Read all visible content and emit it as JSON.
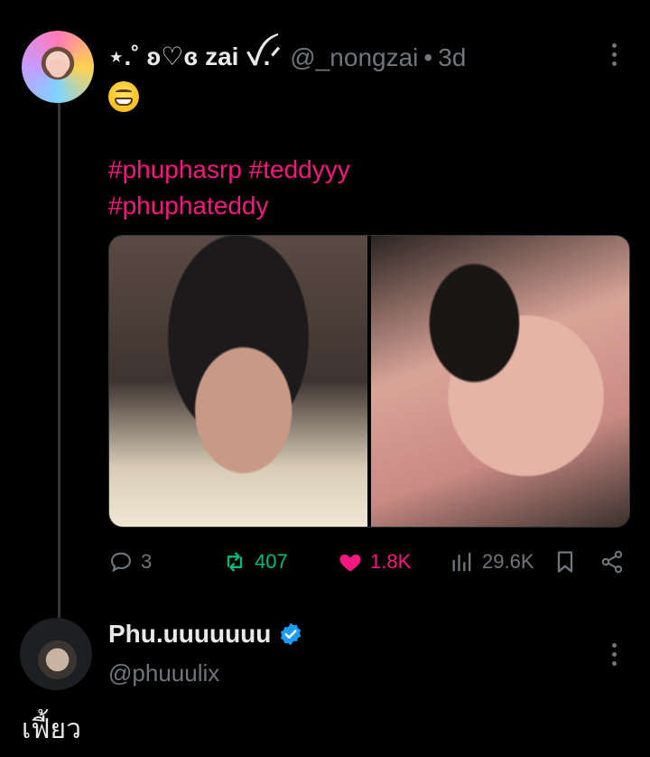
{
  "tweet": {
    "display_name": "⋆.˚ ʚ♡ɞ zai ꪜ.ᐟ",
    "handle": "@_nongzai",
    "separator": "•",
    "time": "3d",
    "emoji_icon": "grinning-face-emoji",
    "hashtags": [
      "#phuphasrp #teddyyy",
      "#phuphateddy"
    ],
    "media_count": 2,
    "stats": {
      "replies": "3",
      "retweets": "407",
      "likes": "1.8K",
      "views": "29.6K"
    }
  },
  "reply": {
    "display_name": "Phu.uuuuuuu",
    "verified": true,
    "handle": "@phuuulix",
    "text": "เฟี้ยว"
  },
  "colors": {
    "background": "#000000",
    "text": "#e7e9ea",
    "muted": "#71767b",
    "hashtag": "#f91880",
    "retweet": "#00ba7c",
    "like": "#f91880",
    "verified": "#1d9bf0"
  }
}
